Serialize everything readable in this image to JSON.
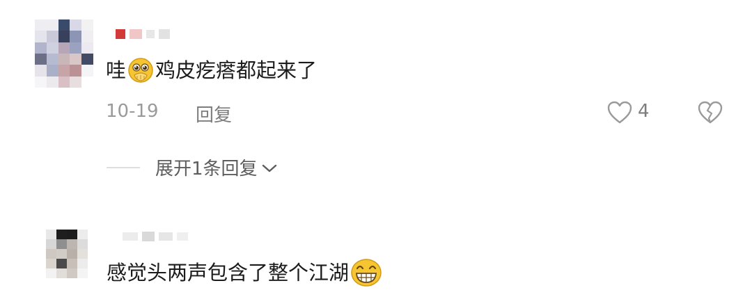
{
  "comments": [
    {
      "text_before": "哇",
      "emoji_icon": "pleading-face-hand-emoji",
      "text_after": "鸡皮疙瘩都起来了",
      "date": "10-19",
      "reply_label": "回复",
      "like_count": "4",
      "expand_label": "展开1条回复"
    },
    {
      "text_before": "感觉头两声包含了整个江湖",
      "emoji_icon": "grinning-teeth-emoji"
    }
  ],
  "colors": {
    "text": "#1b1b1b",
    "meta": "#9a9a9a",
    "emoji_yellow": "#f6c532"
  }
}
